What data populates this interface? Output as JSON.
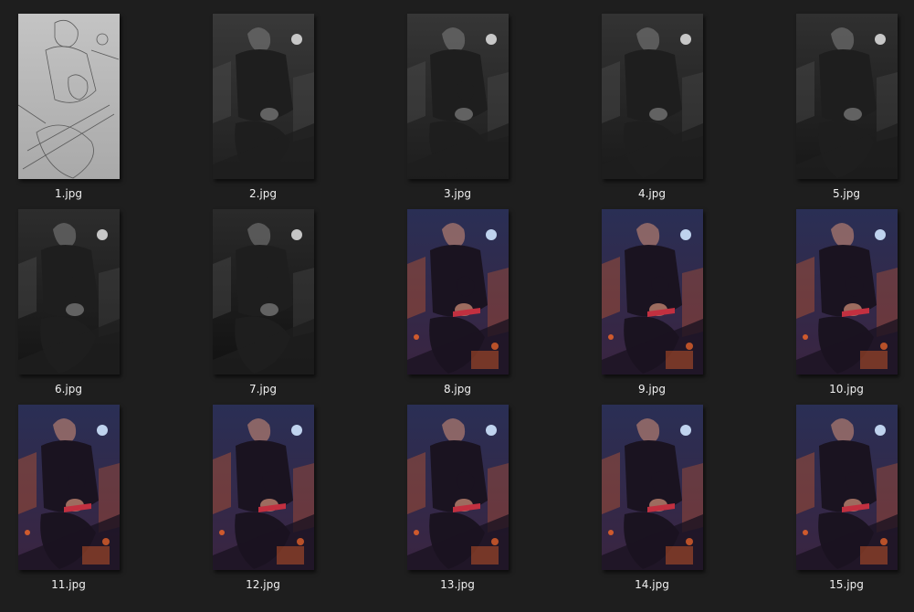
{
  "files": [
    {
      "name": "1.jpg",
      "stage": "sketch"
    },
    {
      "name": "2.jpg",
      "stage": "gray"
    },
    {
      "name": "3.jpg",
      "stage": "gray"
    },
    {
      "name": "4.jpg",
      "stage": "gray"
    },
    {
      "name": "5.jpg",
      "stage": "gray"
    },
    {
      "name": "6.jpg",
      "stage": "gray"
    },
    {
      "name": "7.jpg",
      "stage": "gray"
    },
    {
      "name": "8.jpg",
      "stage": "color"
    },
    {
      "name": "9.jpg",
      "stage": "color"
    },
    {
      "name": "10.jpg",
      "stage": "color"
    },
    {
      "name": "11.jpg",
      "stage": "color"
    },
    {
      "name": "12.jpg",
      "stage": "color"
    },
    {
      "name": "13.jpg",
      "stage": "color"
    },
    {
      "name": "14.jpg",
      "stage": "color"
    },
    {
      "name": "15.jpg",
      "stage": "color"
    }
  ],
  "colors": {
    "background": "#1e1e1e",
    "label": "#f0f0f0",
    "sketch_bg": "#b9b9b9",
    "gray_bg": "#3a3a3a",
    "color_sky": "#2a2f55",
    "color_fire": "#e0602a"
  }
}
